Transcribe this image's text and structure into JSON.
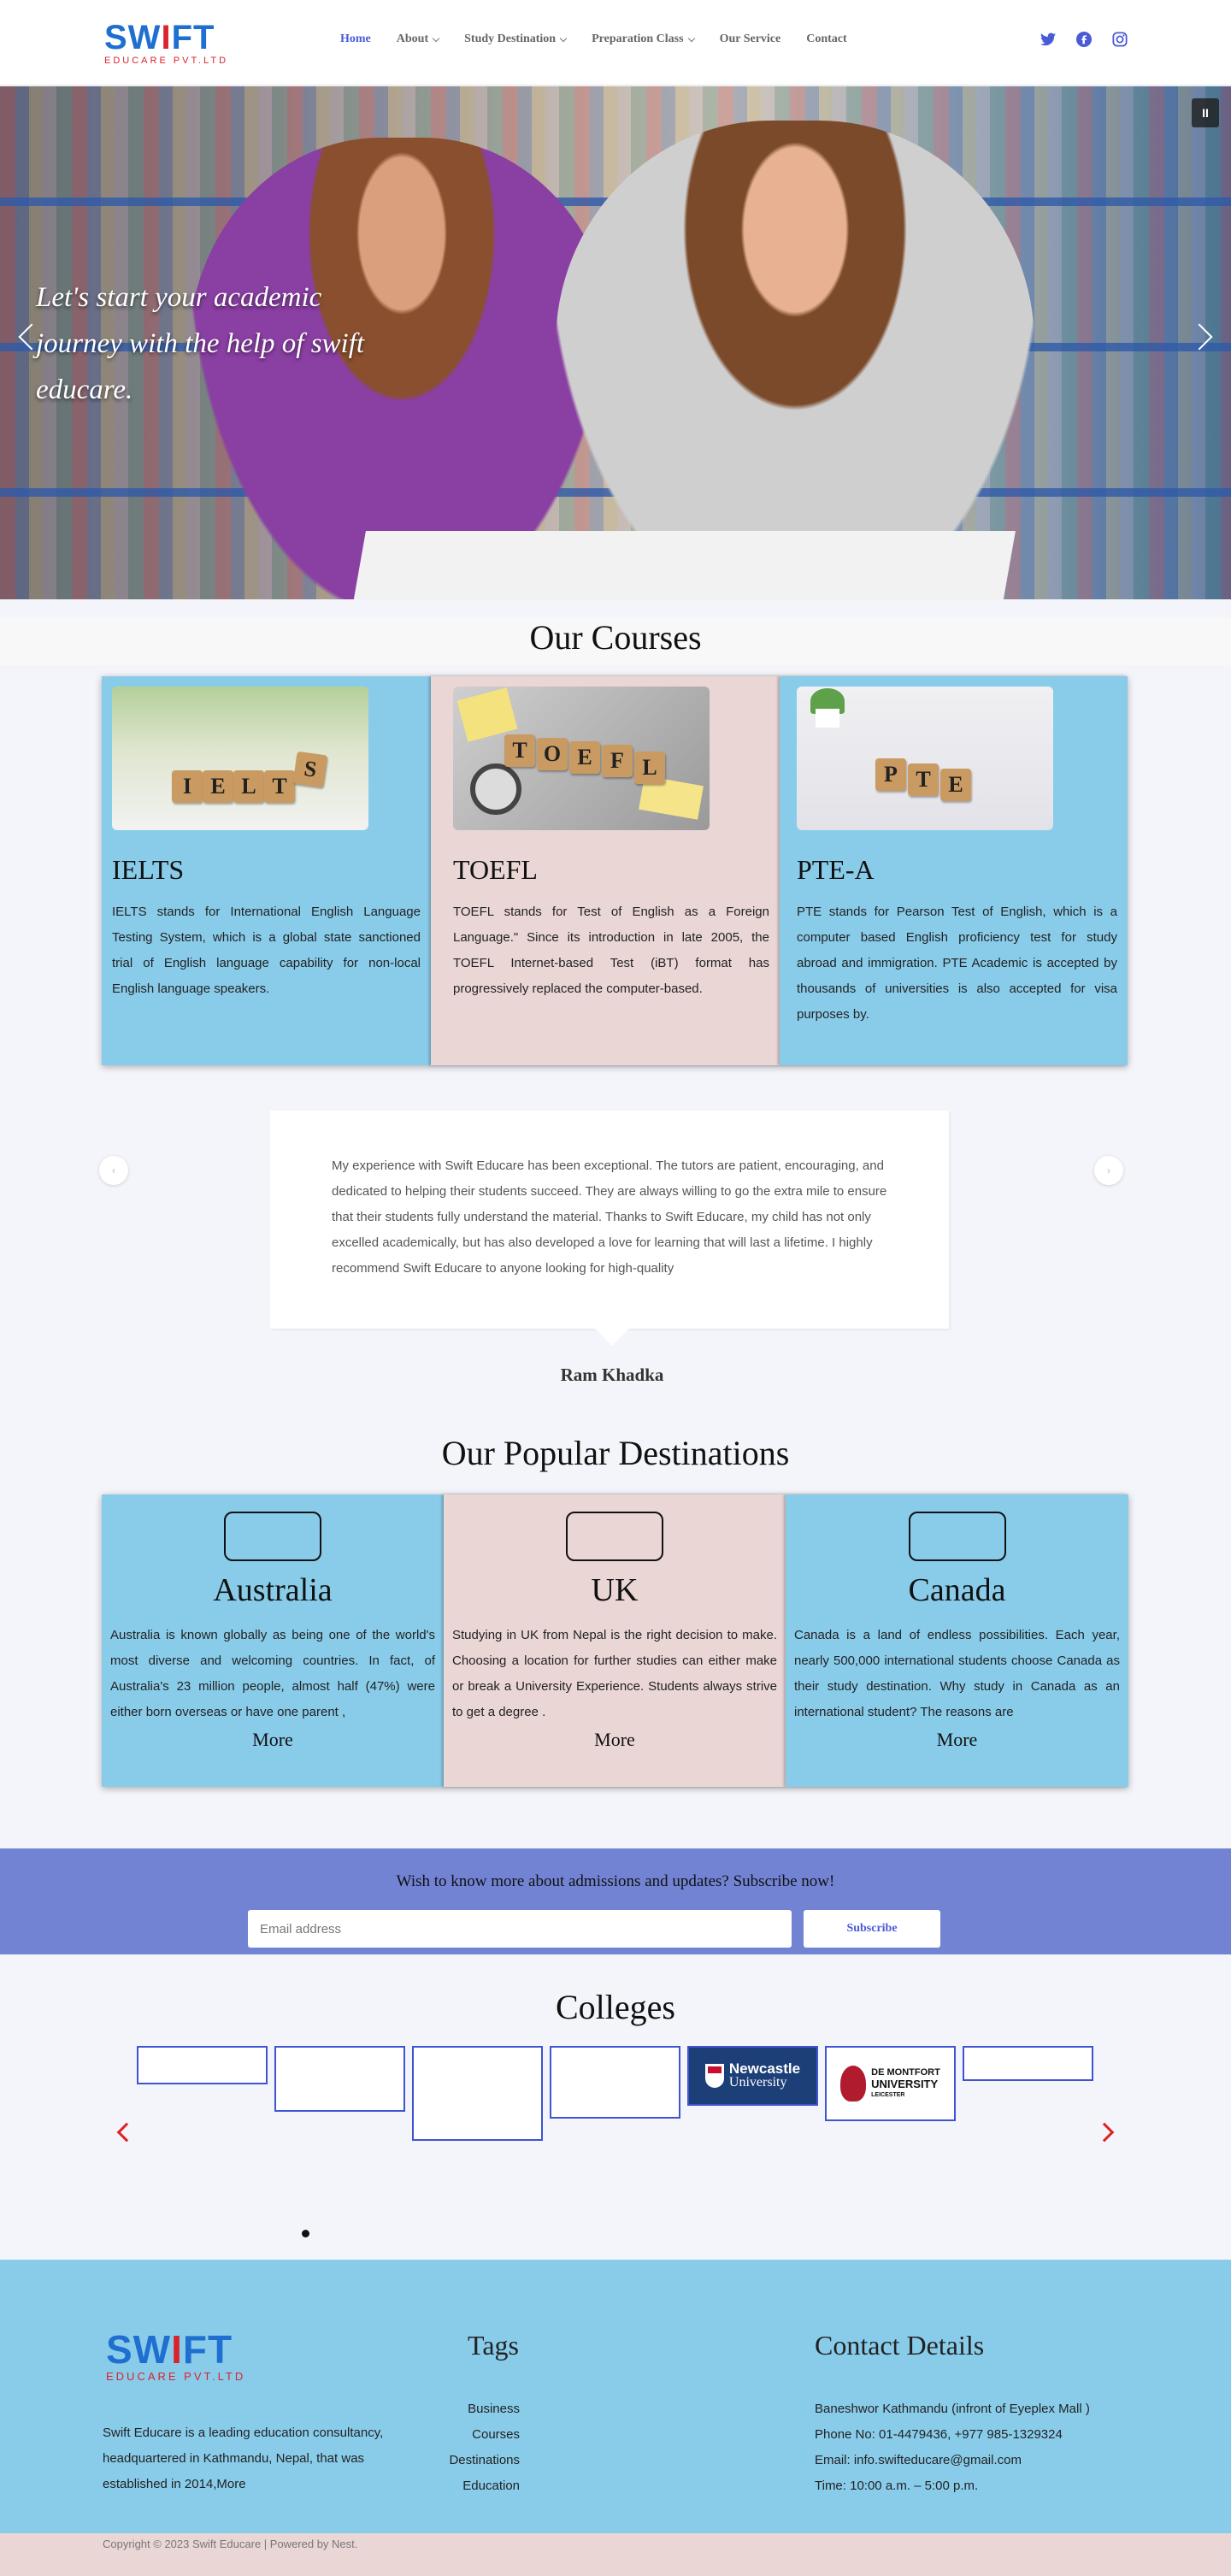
{
  "header": {
    "logo_main_blue": "SW",
    "logo_main_red": "I",
    "logo_main_blue2": "FT",
    "logo_sub": "EDUCARE PVT.LTD",
    "nav": [
      {
        "label": "Home",
        "active": true
      },
      {
        "label": "About",
        "dropdown": true
      },
      {
        "label": "Study Destination",
        "dropdown": true
      },
      {
        "label": "Preparation Class",
        "dropdown": true
      },
      {
        "label": "Our Service"
      },
      {
        "label": "Contact"
      }
    ],
    "social_icons": [
      "twitter-icon",
      "facebook-icon",
      "instagram-icon"
    ],
    "accent": "#4a5bd8"
  },
  "hero": {
    "text": "Let's start your academic journey with the help of swift educare.",
    "pause_label": "II"
  },
  "courses": {
    "title": "Our Courses",
    "items": [
      {
        "title": "IELTS",
        "image_letters": "IELTS",
        "text": "IELTS stands for International English Language Testing System, which is a global state sanctioned trial of English language capability for non-local English language speakers."
      },
      {
        "title": "TOEFL",
        "image_letters": "TOEFL",
        "text": "TOEFL stands for Test of English as a Foreign Language.\" Since its introduction in late 2005, the TOEFL Internet-based Test (iBT) format has progressively replaced the computer-based."
      },
      {
        "title": "PTE-A",
        "image_letters": "PTE",
        "text": "PTE stands for Pearson Test of English, which is a computer based English proficiency test for study abroad and immigration. PTE Academic is accepted by thousands of universities is also accepted for visa purposes by."
      }
    ]
  },
  "testimonial": {
    "text": "My experience with Swift Educare has been exceptional. The tutors are patient, encouraging, and dedicated to helping their students succeed. They are always willing to go the extra mile to ensure that their students fully understand the material. Thanks to Swift Educare, my child has not only excelled academically, but has also developed a love for learning that will last a lifetime. I highly recommend Swift Educare to anyone looking for high-quality",
    "name": "Ram Khadka"
  },
  "destinations": {
    "title": "Our Popular Destinations",
    "more_label": "More",
    "items": [
      {
        "title": "Australia",
        "text": "Australia is known globally as being one of the world's most diverse and welcoming countries. In fact, of Australia's 23 million people, almost half (47%) were either born overseas or have one parent ,"
      },
      {
        "title": "UK",
        "text": "Studying in UK from Nepal is the right decision to make. Choosing a location for further studies can either make or break a University Experience. Students always strive to get a degree ."
      },
      {
        "title": "Canada",
        "text": "Canada is a land of endless possibilities. Each year, nearly 500,000 international students choose Canada as their study destination. Why study in Canada as an international student? The reasons are"
      }
    ]
  },
  "subscribe": {
    "title": "Wish to know more about admissions and updates? Subscribe now!",
    "placeholder": "Email address",
    "button": "Subscribe"
  },
  "colleges": {
    "title": "Colleges",
    "newcastle_name": "Newcastle",
    "newcastle_sub": "University",
    "demontfort_line1": "DE MONTFORT",
    "demontfort_line2": "UNIVERSITY",
    "demontfort_line3": "LEICESTER"
  },
  "footer": {
    "about": "Swift Educare is a leading education consultancy, headquartered in Kathmandu, Nepal, that was established in 2014,More",
    "tags_title": "Tags",
    "tags": [
      "Business",
      "Courses",
      "Destinations",
      "Education"
    ],
    "contact_title": "Contact Details",
    "contact": [
      "Baneshwor Kathmandu (infront of Eyeplex Mall )",
      "Phone No: 01-4479436, +977 985-1329324",
      "Email: info.swifteducare@gmail.com",
      "Time: 10:00 a.m. – 5:00 p.m."
    ],
    "copyright": "Copyright © 2023 Swift Educare | Powered by Nest."
  }
}
